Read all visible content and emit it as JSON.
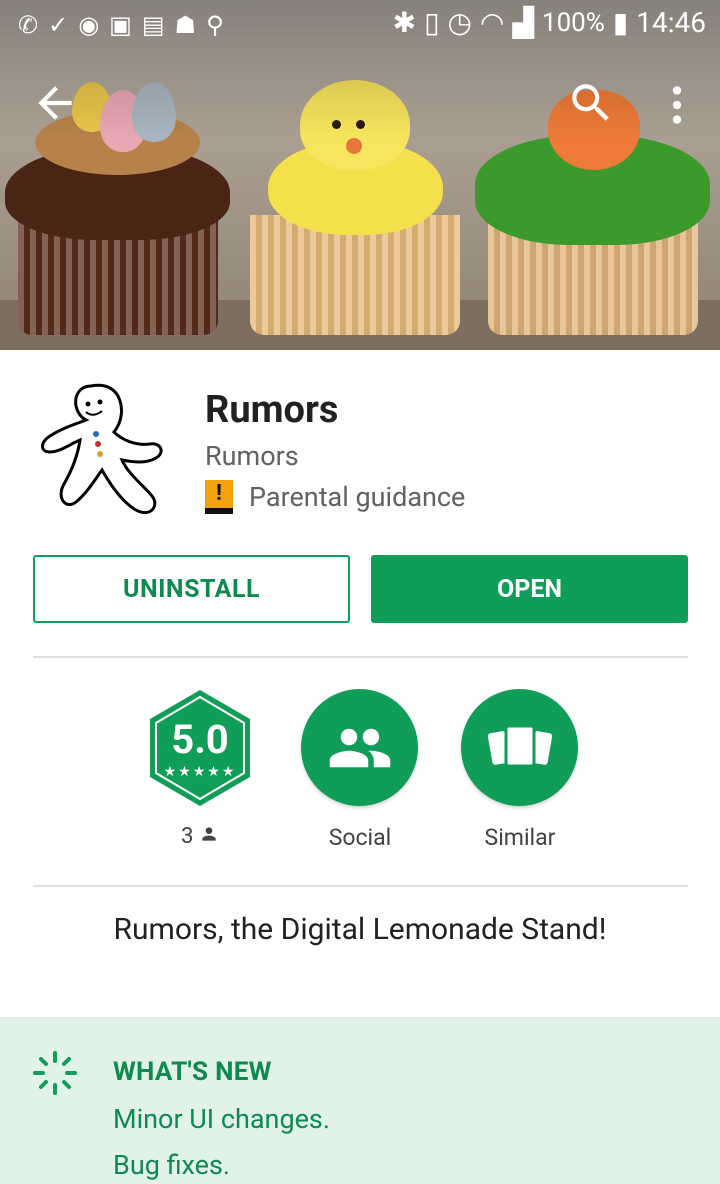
{
  "status_bar": {
    "battery_percent": "100%",
    "time": "14:46",
    "icons": [
      "missed-call-icon",
      "check-icon",
      "notification-icon",
      "sync-icon",
      "message-icon",
      "android-icon",
      "usb-icon",
      "bluetooth-icon",
      "vibrate-icon",
      "alarm-icon",
      "wifi-icon",
      "signal-icon",
      "battery-charging-icon"
    ]
  },
  "toolbar": {
    "back_icon": "arrow-back-icon",
    "search_icon": "search-icon",
    "more_icon": "more-vert-icon"
  },
  "app": {
    "title": "Rumors",
    "developer": "Rumors",
    "content_rating": "Parental guidance",
    "content_rating_symbol": "!"
  },
  "buttons": {
    "uninstall": "UNINSTALL",
    "open": "OPEN"
  },
  "stats": {
    "rating": "5.0",
    "stars": "★★★★★",
    "rating_count": "3",
    "social_label": "Social",
    "similar_label": "Similar"
  },
  "tagline": "Rumors, the Digital Lemonade Stand!",
  "whats_new": {
    "title": "WHAT'S NEW",
    "lines": [
      "Minor UI changes.",
      "Bug fixes."
    ]
  },
  "colors": {
    "accent_green": "#0f9d58",
    "whats_new_bg": "#e1f2e7",
    "pg_badge": "#f3a10d"
  }
}
